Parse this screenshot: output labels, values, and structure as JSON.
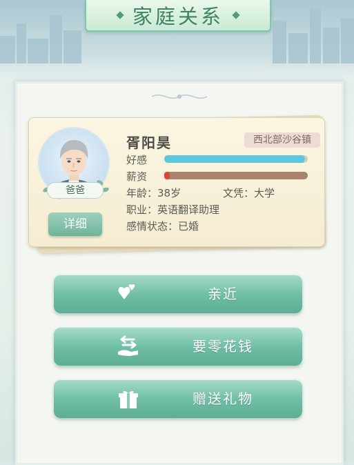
{
  "header": {
    "title": "家庭关系"
  },
  "character": {
    "name": "胥阳昊",
    "relation": "爸爸",
    "location": "西北部沙谷镇",
    "favor_label": "好感",
    "favor_value": 0.98,
    "salary_label": "薪资",
    "salary_value": 0.04,
    "age_line": "年龄：38岁",
    "education_line": "文凭：大学",
    "job_line": "职业：英语翻译助理",
    "relationship_line": "感情状态：已婚"
  },
  "detail_button": {
    "label": "详细"
  },
  "actions": [
    {
      "label": "亲近",
      "icon": "hearts-icon"
    },
    {
      "label": "要零花钱",
      "icon": "exchange-hand-icon"
    },
    {
      "label": "赠送礼物",
      "icon": "gift-icon"
    }
  ],
  "colors": {
    "favor_bar": "#5ec6dd",
    "salary_bar": "#a8826c",
    "salary_marker": "#e0433a",
    "accent": "#6ebda4"
  }
}
